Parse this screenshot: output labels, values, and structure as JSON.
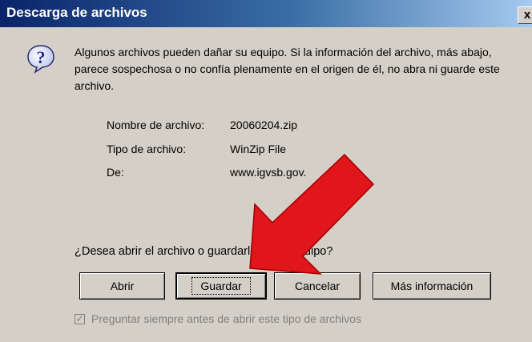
{
  "window": {
    "title": "Descarga de archivos",
    "close_label": "x"
  },
  "message": "Algunos archivos pueden dañar su equipo. Si la información del archivo, más abajo, parece sospechosa o no confía plenamente en el origen de él, no abra ni guarde este archivo.",
  "file_info": {
    "name_label": "Nombre de archivo:",
    "name_value": "20060204.zip",
    "type_label": "Tipo de archivo:",
    "type_value": "WinZip File",
    "from_label": "De:",
    "from_value": "www.igvsb.gov."
  },
  "question": "¿Desea abrir el archivo o guardarlo en su equipo?",
  "buttons": {
    "open": "Abrir",
    "save": "Guardar",
    "cancel": "Cancelar",
    "more_info": "Más información"
  },
  "checkbox": {
    "label": "Preguntar siempre antes de abrir este tipo de archivos",
    "checked": true,
    "enabled": false
  },
  "icons": {
    "question": "question-icon",
    "arrow": "red-arrow-icon"
  },
  "colors": {
    "title_bar_start": "#0a246a",
    "title_bar_end": "#a6caf0",
    "dialog_bg": "#d4d0c8",
    "arrow": "#e0161b"
  }
}
